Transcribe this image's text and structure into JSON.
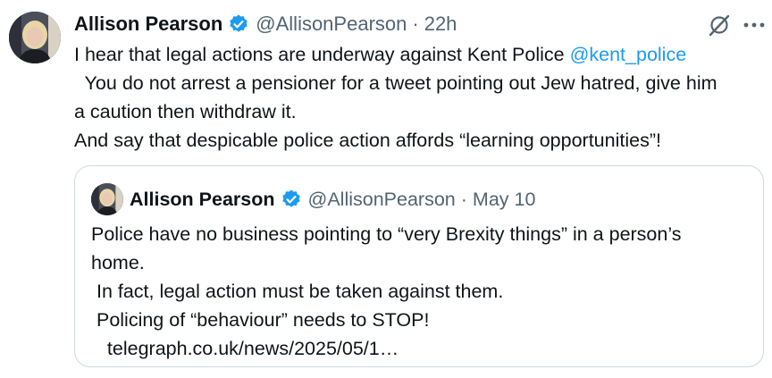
{
  "tweet": {
    "author_name": "Allison Pearson",
    "author_handle": "@AllisonPearson",
    "separator": "·",
    "time": "22h",
    "text_line1_prefix": "I hear that legal actions are underway against Kent Police ",
    "mention": "@kent_police",
    "text_line2": "  You do not arrest a pensioner for a tweet pointing out Jew hatred, give him",
    "text_line3": "a caution then withdraw it.",
    "text_line4": "And say that despicable police action affords “learning opportunities”!"
  },
  "quote": {
    "author_name": "Allison Pearson",
    "author_handle": "@AllisonPearson",
    "separator": "·",
    "date": "May 10",
    "lines": [
      "Police have no business pointing to “very Brexity things” in a person’s",
      "home.",
      " In fact, legal action must be taken against them.",
      " Policing of “behaviour” needs to STOP!",
      "   telegraph.co.uk/news/2025/05/1…"
    ]
  },
  "icons": {
    "verified": "verified-badge-icon",
    "grok": "grok-icon",
    "more": "more-options-icon"
  },
  "colors": {
    "accent": "#1d9bf0",
    "text": "#0f1419",
    "muted": "#536471",
    "border": "#cfd9de"
  }
}
